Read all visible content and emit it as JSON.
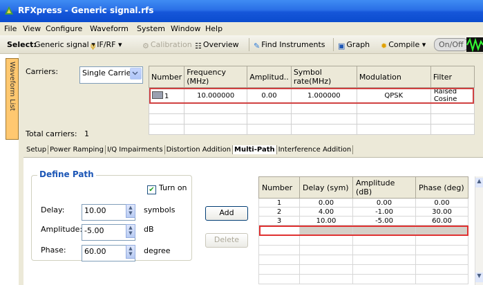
{
  "window": {
    "title": "RFXpress - Generic signal.rfs"
  },
  "menu": [
    "File",
    "View",
    "Configure",
    "Waveform",
    "System",
    "Window",
    "Help"
  ],
  "toolbar": {
    "select_label": "Select:",
    "select_value": "Generic signal",
    "ifrf": "IF/RF",
    "calibration": "Calibration",
    "overview": "Overview",
    "find_instruments": "Find Instruments",
    "graph": "Graph",
    "compile": "Compile",
    "onoff": "On/Off"
  },
  "side_tab": "Waveform List",
  "carriers": {
    "label": "Carriers:",
    "mode": "Single Carrier",
    "columns": [
      "Number",
      "Frequency (MHz)",
      "Amplitud..",
      "Symbol rate(MHz)",
      "Modulation",
      "Filter"
    ],
    "rows": [
      [
        "1",
        "10.000000",
        "0.00",
        "1.000000",
        "QPSK",
        "Raised Cosine"
      ]
    ],
    "total_label": "Total carriers:",
    "total_value": "1"
  },
  "tabs": [
    "Setup",
    "Power Ramping",
    "I/Q Impairments",
    "Distortion Addition",
    "Multi-Path",
    "Interference Addition"
  ],
  "active_tab": "Multi-Path",
  "define_path": {
    "title": "Define Path",
    "turn_on_label": "Turn on",
    "turn_on": true,
    "delay_label": "Delay:",
    "delay_value": "10.00",
    "delay_unit": "symbols",
    "amplitude_label": "Amplitude:",
    "amplitude_value": "-5.00",
    "amplitude_unit": "dB",
    "phase_label": "Phase:",
    "phase_value": "60.00",
    "phase_unit": "degree",
    "add_button": "Add",
    "delete_button": "Delete"
  },
  "paths": {
    "columns": [
      "Number",
      "Delay (sym)",
      "Amplitude (dB)",
      "Phase (deg)"
    ],
    "rows": [
      [
        "1",
        "0.00",
        "0.00",
        "0.00"
      ],
      [
        "2",
        "4.00",
        "-1.00",
        "30.00"
      ],
      [
        "3",
        "10.00",
        "-5.00",
        "60.00"
      ]
    ]
  },
  "colors": {
    "title_bar": "#2a6fe6",
    "accent": "#1c56b6",
    "selection_border": "#e03030"
  }
}
